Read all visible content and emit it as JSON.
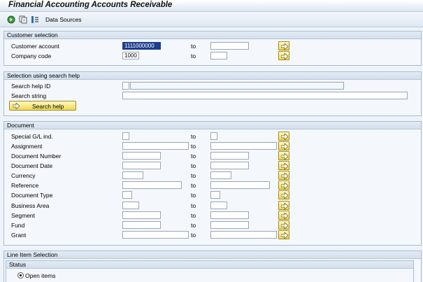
{
  "window": {
    "title": "Financial Accounting Accounts Receivable"
  },
  "toolbar": {
    "icons": [
      "execute-icon",
      "get-variant-icon",
      "selection-options-icon"
    ],
    "data_sources_label": "Data Sources"
  },
  "customer_selection": {
    "header": "Customer selection",
    "customer_account": {
      "label": "Customer account",
      "from": "1111000000",
      "to_label": "to",
      "to": ""
    },
    "company_code": {
      "label": "Company code",
      "from": "1000",
      "to_label": "to",
      "to": ""
    }
  },
  "search_help_section": {
    "header": "Selection using search help",
    "search_help_id": {
      "label": "Search help ID",
      "value": "",
      "description": ""
    },
    "search_string": {
      "label": "Search string",
      "value": ""
    },
    "search_help_button": "Search help"
  },
  "document": {
    "header": "Document",
    "to_label": "to",
    "rows": [
      {
        "label": "Special G/L ind.",
        "from": "",
        "to": ""
      },
      {
        "label": "Assignment",
        "from": "",
        "to": ""
      },
      {
        "label": "Document Number",
        "from": "",
        "to": ""
      },
      {
        "label": "Document Date",
        "from": "",
        "to": ""
      },
      {
        "label": "Currency",
        "from": "",
        "to": ""
      },
      {
        "label": "Reference",
        "from": "",
        "to": ""
      },
      {
        "label": "Document Type",
        "from": "",
        "to": ""
      },
      {
        "label": "Business Area",
        "from": "",
        "to": ""
      },
      {
        "label": "Segment",
        "from": "",
        "to": ""
      },
      {
        "label": "Fund",
        "from": "",
        "to": ""
      },
      {
        "label": "Grant",
        "from": "",
        "to": ""
      }
    ]
  },
  "line_item_selection": {
    "header": "Line Item Selection",
    "status_header": "Status",
    "open_items_label": "Open items"
  },
  "colors": {
    "selected_field": "#1c3c8c",
    "button_yellow": "#f2d94e",
    "group_border": "#a9bdd3"
  }
}
